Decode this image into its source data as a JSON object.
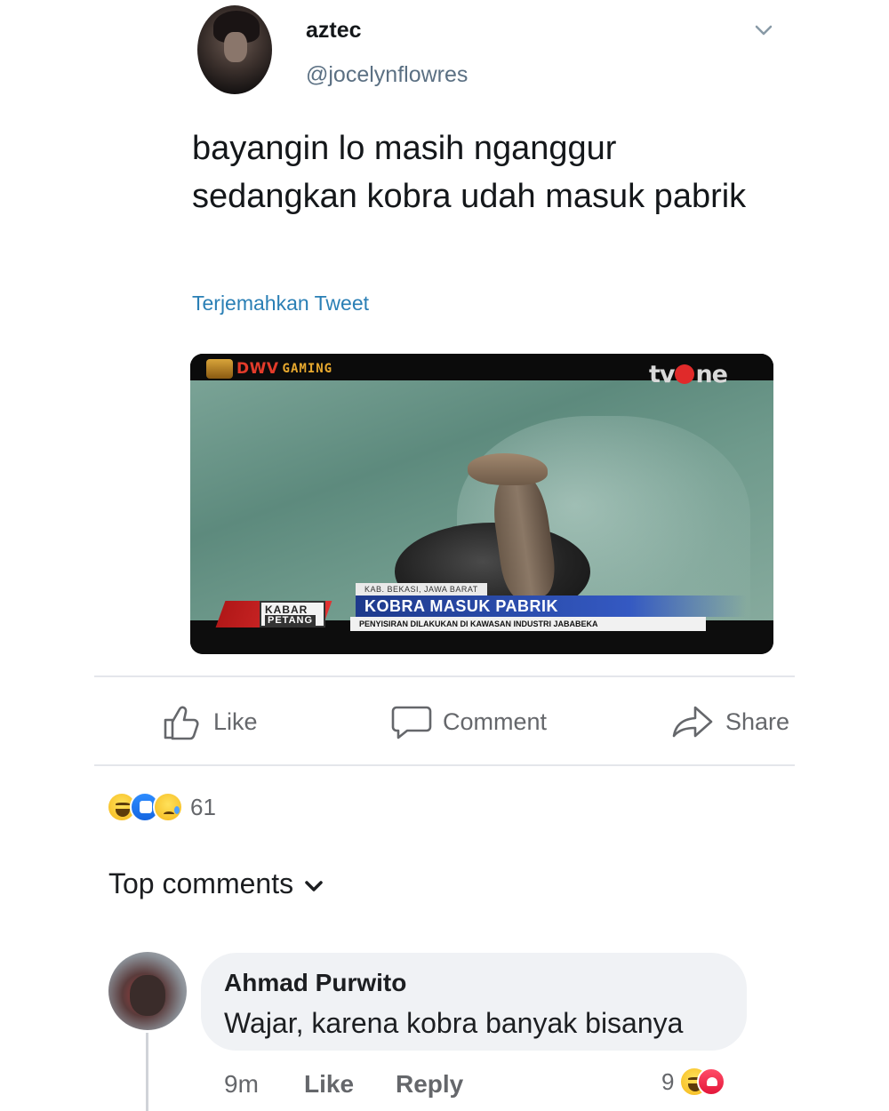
{
  "tweet": {
    "display_name": "aztec",
    "handle": "@jocelynflowres",
    "text": "bayangin lo masih nganggur sedangkan kobra udah masuk pabrik",
    "translate_label": "Terjemahkan Tweet",
    "media": {
      "watermark_dwv": "DWV",
      "watermark_gaming": "GAMING",
      "channel_logo_left": "tv",
      "channel_logo_right": "ne",
      "show_tag_top": "KABAR",
      "show_tag_bottom": "PETANG",
      "location": "KAB. BEKASI, JAWA BARAT",
      "headline": "KOBRA MASUK PABRIK",
      "subheadline": "PENYISIRAN DILAKUKAN DI KAWASAN INDUSTRI JABABEKA"
    }
  },
  "actions": {
    "like": "Like",
    "comment": "Comment",
    "share": "Share"
  },
  "reactions": {
    "types": [
      "haha",
      "like",
      "sad"
    ],
    "count": "61"
  },
  "comments_header": "Top comments",
  "comment": {
    "author": "Ahmad Purwito",
    "text": "Wajar, karena kobra banyak bisanya",
    "time": "9m",
    "like_label": "Like",
    "reply_label": "Reply",
    "reaction_count": "9",
    "reaction_types": [
      "haha",
      "love"
    ]
  },
  "colors": {
    "link_blue": "#2a7fb5",
    "muted_gray": "#65676b",
    "bubble_bg": "#f0f2f5",
    "headline_blue": "#1e3a8c",
    "tv_red": "#e02a2a"
  }
}
